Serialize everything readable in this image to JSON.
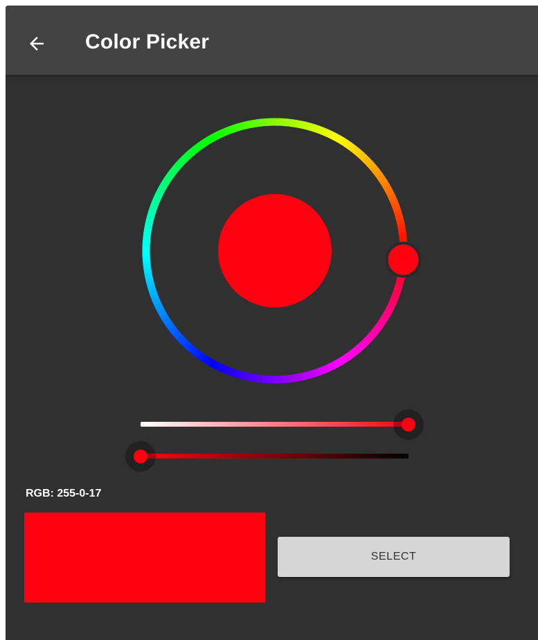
{
  "appbar": {
    "title": "Color Picker",
    "back_icon": "arrow-left-icon"
  },
  "selected_color": "#FF0011",
  "hue_degrees": 356,
  "saturation": 1.0,
  "value": 1.0,
  "rgb_label": "RGB: 255-0-17",
  "select_button_label": "SELECT",
  "colors": {
    "background": "#303030",
    "appbar": "#424242",
    "button": "#D6D6D6"
  }
}
